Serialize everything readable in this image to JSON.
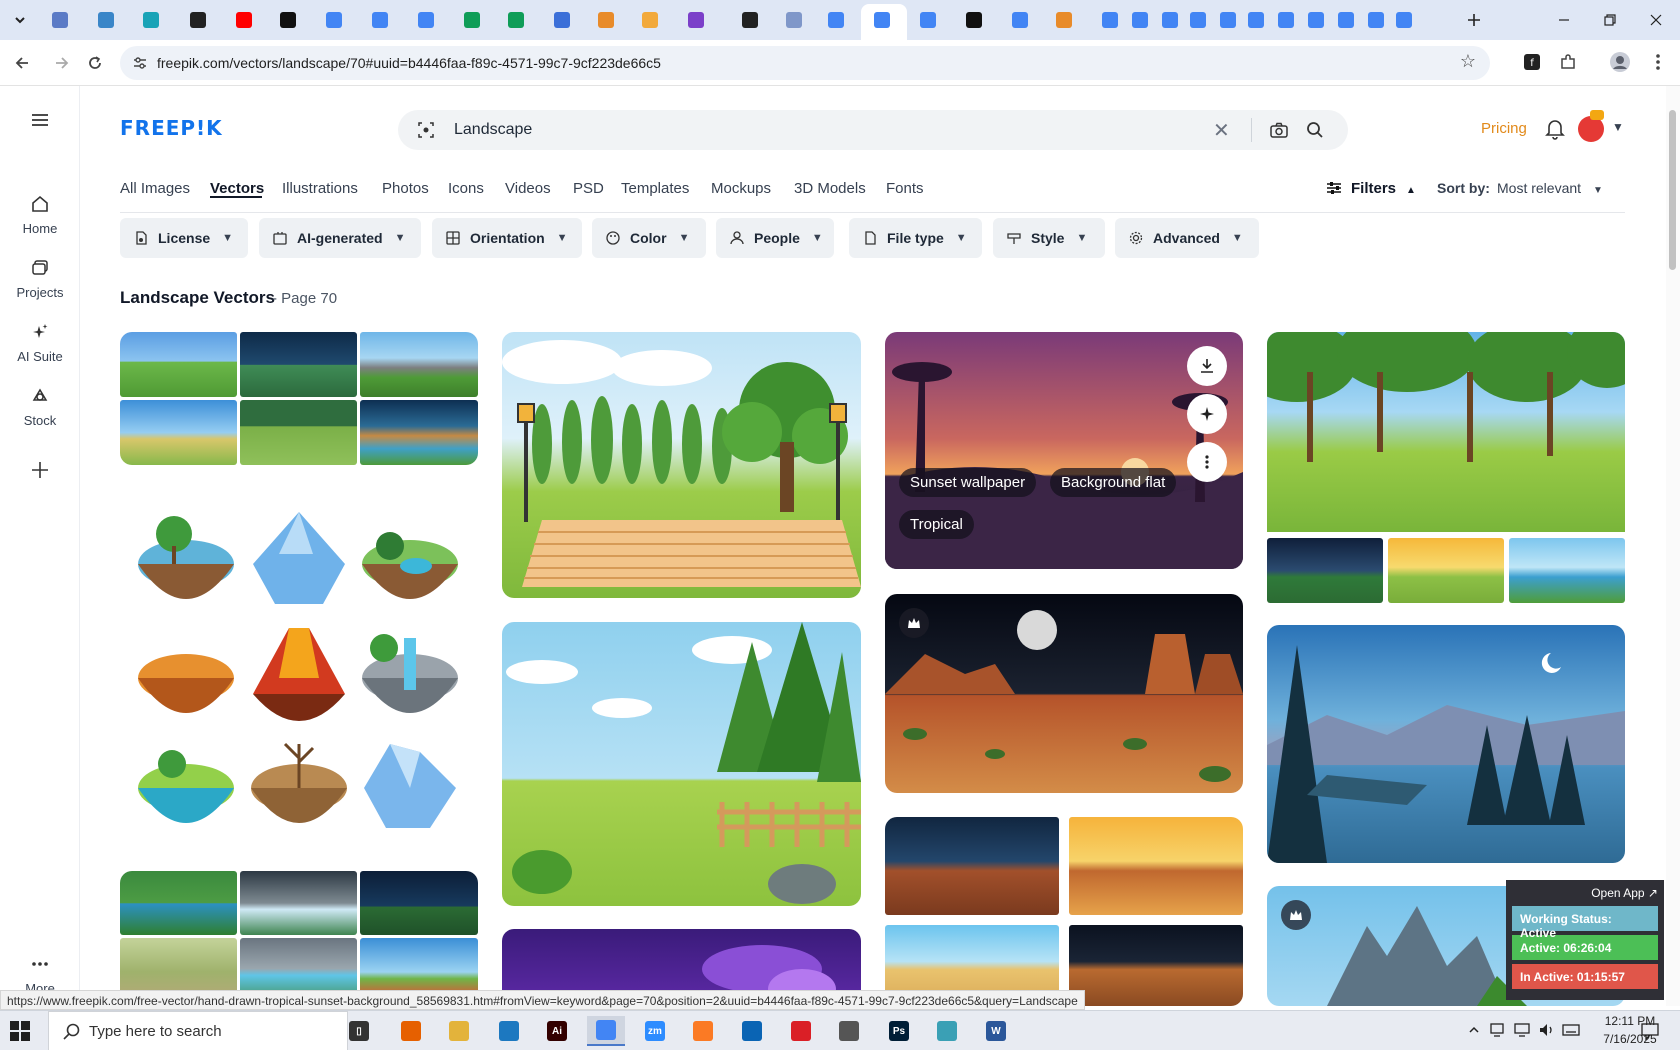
{
  "browser": {
    "tab_favicon_colors": [
      "#5b7bc6",
      "#3a86c8",
      "#19a3b7",
      "#222222",
      "#ff0000",
      "#111111",
      "#4285f4",
      "#4285f4",
      "#4285f4",
      "#0f9d58",
      "#0f9d58",
      "#3b6fd8",
      "#e88b2a",
      "#f2a93b",
      "#7b3fc9",
      "#222222",
      "#7f97c9",
      "#4285f4",
      "#4285f4",
      "#4285f4",
      "#111111",
      "#4285f4",
      "#e88b2a",
      "#4285f4",
      "#4285f4",
      "#4285f4",
      "#4285f4",
      "#4285f4",
      "#4285f4",
      "#4285f4",
      "#4285f4",
      "#4285f4",
      "#4285f4",
      "#4285f4"
    ],
    "url": "freepik.com/vectors/landscape/70#uuid=b4446faa-f89c-4571-99c7-9cf223de66c5",
    "status_url": "https://www.freepik.com/free-vector/hand-drawn-tropical-sunset-background_58569831.htm#fromView=keyword&page=70&position=2&uuid=b4446faa-f89c-4571-99c7-9cf223de66c5&query=Landscape"
  },
  "site": {
    "logo": "FREEP!K",
    "search": {
      "query": "Landscape"
    },
    "pricing": "Pricing",
    "rail": [
      {
        "label": "Home",
        "icon": "home-icon"
      },
      {
        "label": "Projects",
        "icon": "projects-icon"
      },
      {
        "label": "AI Suite",
        "icon": "sparkle-icon"
      },
      {
        "label": "Stock",
        "icon": "stock-icon"
      },
      {
        "label": "More",
        "icon": "more-dots-icon"
      }
    ],
    "categories": [
      "All Images",
      "Vectors",
      "Illustrations",
      "Photos",
      "Icons",
      "Videos",
      "PSD",
      "Templates",
      "Mockups",
      "3D Models",
      "Fonts"
    ],
    "active_category": "Vectors",
    "filters_label": "Filters",
    "sort_label": "Sort by:",
    "sort_value": "Most relevant",
    "chips": [
      "License",
      "AI-generated",
      "Orientation",
      "Color",
      "People",
      "File type",
      "Style",
      "Advanced"
    ],
    "results_title": "Landscape Vectors",
    "results_page": "- Page 70",
    "hover_tags": [
      "Sunset wallpaper",
      "Background flat",
      "Tropical"
    ]
  },
  "tracker": {
    "open_app": "Open App ↗",
    "working_status": "Working Status: Active",
    "active": "Active: 06:26:04",
    "inactive": "In Active: 01:15:57",
    "colors": {
      "working": "#6fb7c9",
      "active": "#4cbf56",
      "inactive": "#e0564a"
    }
  },
  "taskbar": {
    "search_placeholder": "Type here to search",
    "time": "12:11 PM",
    "date": "7/16/2025",
    "apps": [
      {
        "name": "Task View",
        "color": "#333333",
        "label": "▯"
      },
      {
        "name": "Firefox",
        "color": "#e66000",
        "label": ""
      },
      {
        "name": "File Explorer",
        "color": "#e3b33b",
        "label": ""
      },
      {
        "name": "VS Code",
        "color": "#1c78c0",
        "label": ""
      },
      {
        "name": "Illustrator",
        "color": "#330000",
        "label": "Ai"
      },
      {
        "name": "Chrome",
        "color": "#4285f4",
        "label": ""
      },
      {
        "name": "Zoom",
        "color": "#2d8cff",
        "label": "zm"
      },
      {
        "name": "XAMPP",
        "color": "#fb7a24",
        "label": ""
      },
      {
        "name": "Outlook",
        "color": "#0a64b4",
        "label": ""
      },
      {
        "name": "Creative Cloud",
        "color": "#da1f26",
        "label": ""
      },
      {
        "name": "Pen Tool",
        "color": "#555555",
        "label": ""
      },
      {
        "name": "Photoshop",
        "color": "#001e36",
        "label": "Ps"
      },
      {
        "name": "App",
        "color": "#3aa0b5",
        "label": ""
      },
      {
        "name": "Word",
        "color": "#2b579a",
        "label": "W"
      }
    ]
  }
}
